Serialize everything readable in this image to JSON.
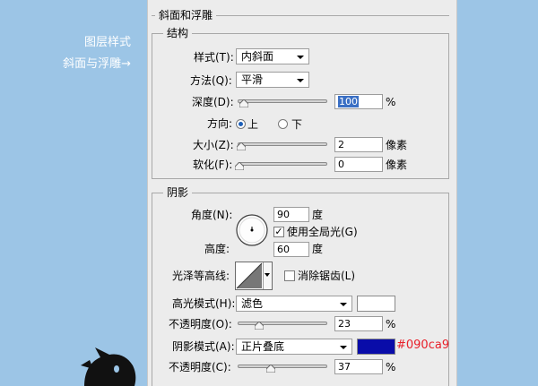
{
  "side": {
    "layer_style": "图层样式",
    "bevel_emboss": "斜面与浮雕→"
  },
  "bevel": {
    "section_title": "斜面和浮雕",
    "structure": {
      "title": "结构",
      "style_label": "样式(T):",
      "style_value": "内斜面",
      "technique_label": "方法(Q):",
      "technique_value": "平滑",
      "depth_label": "深度(D):",
      "depth_value": "100",
      "depth_percent": 1.0,
      "direction_label": "方向:",
      "direction_up": "上",
      "direction_down": "下",
      "direction_selected": "up",
      "size_label": "大小(Z):",
      "size_value": "2",
      "size_unit": "像素",
      "soften_label": "软化(F):",
      "soften_value": "0",
      "soften_unit": "像素",
      "percent_unit": "%"
    },
    "shading": {
      "title": "阴影",
      "angle_label": "角度(N):",
      "angle_value": "90",
      "angle_unit": "度",
      "global_light_label": "使用全局光(G)",
      "global_light_checked": true,
      "altitude_label": "高度:",
      "altitude_value": "60",
      "altitude_unit": "度",
      "gloss_contour_label": "光泽等高线:",
      "anti_alias_label": "消除锯齿(L)",
      "anti_alias_checked": false,
      "highlight_mode_label": "高光模式(H):",
      "highlight_mode_value": "滤色",
      "highlight_color": "#ffffff",
      "highlight_opacity_label": "不透明度(O):",
      "highlight_opacity_value": "23",
      "highlight_opacity": 0.23,
      "shadow_mode_label": "阴影模式(A):",
      "shadow_mode_value": "正片叠底",
      "shadow_color": "#090ca9",
      "shadow_color_text": "#090ca9",
      "shadow_opacity_label": "不透明度(C):",
      "shadow_opacity_value": "37",
      "shadow_opacity": 0.37,
      "percent_unit": "%"
    }
  }
}
